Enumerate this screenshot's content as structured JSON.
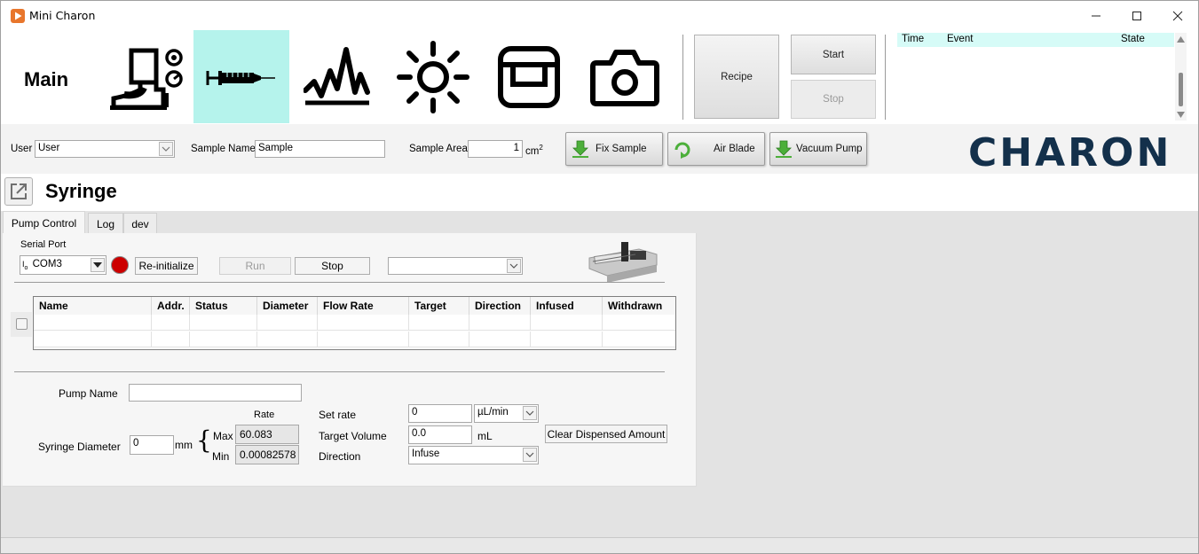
{
  "window": {
    "title": "Mini Charon",
    "minimize_icon": "minimize-icon",
    "maximize_icon": "maximize-icon",
    "close_icon": "close-icon"
  },
  "toolbar": {
    "main_label": "Main",
    "nav": [
      {
        "name": "instrument-icon"
      },
      {
        "name": "syringe-icon",
        "active": true
      },
      {
        "name": "spectrum-icon"
      },
      {
        "name": "light-icon"
      },
      {
        "name": "sample-holder-icon"
      },
      {
        "name": "camera-icon"
      }
    ],
    "recipe_label": "Recipe",
    "start_label": "Start",
    "stop_label": "Stop",
    "accent_color": "#b5f3ec"
  },
  "event_log": {
    "columns": [
      "Time",
      "Event",
      "State"
    ]
  },
  "sample_bar": {
    "user_label": "User",
    "user_value": "User",
    "sample_name_label": "Sample Name",
    "sample_name_value": "Sample",
    "sample_area_label": "Sample Area",
    "sample_area_value": "1",
    "sample_area_unit": "cm",
    "sample_area_unit_sup": "2",
    "fix_sample_label": "Fix Sample",
    "air_blade_label": "Air Blade",
    "vacuum_pump_label": "Vacuum Pump",
    "logo_text": "CHARON",
    "brand_color": "#13304b"
  },
  "section": {
    "title": "Syringe"
  },
  "tabs": [
    {
      "label": "Pump Control",
      "active": true
    },
    {
      "label": "Log"
    },
    {
      "label": "dev"
    }
  ],
  "pump_control": {
    "serial_port_label": "Serial Port",
    "serial_port_value": "COM3",
    "serial_port_prefix": "I/O",
    "status_color": "#cc0000",
    "reinit_label": "Re-initialize",
    "run_label": "Run",
    "stop_label": "Stop",
    "pump_select_value": "",
    "table": {
      "columns": [
        "Name",
        "Addr.",
        "Status",
        "Diameter",
        "Flow Rate",
        "Target",
        "Direction",
        "Infused",
        "Withdrawn"
      ],
      "rows": [
        [
          "",
          "",
          "",
          "",
          "",
          "",
          "",
          "",
          ""
        ],
        [
          "",
          "",
          "",
          "",
          "",
          "",
          "",
          "",
          ""
        ]
      ]
    },
    "pump_name_label": "Pump Name",
    "pump_name_value": "",
    "syringe_diameter_label": "Syringe Diameter",
    "syringe_diameter_value": "0",
    "diameter_unit": "mm",
    "rate_label": "Rate",
    "max_label": "Max",
    "max_value": "60.083",
    "min_label": "Min",
    "min_value": "0.00082578",
    "set_rate_label": "Set rate",
    "set_rate_value": "0",
    "set_rate_unit": "µL/min",
    "target_volume_label": "Target Volume",
    "target_volume_value": "0.0",
    "target_volume_unit": "mL",
    "direction_label": "Direction",
    "direction_value": "Infuse",
    "clear_label": "Clear Dispensed Amount"
  }
}
